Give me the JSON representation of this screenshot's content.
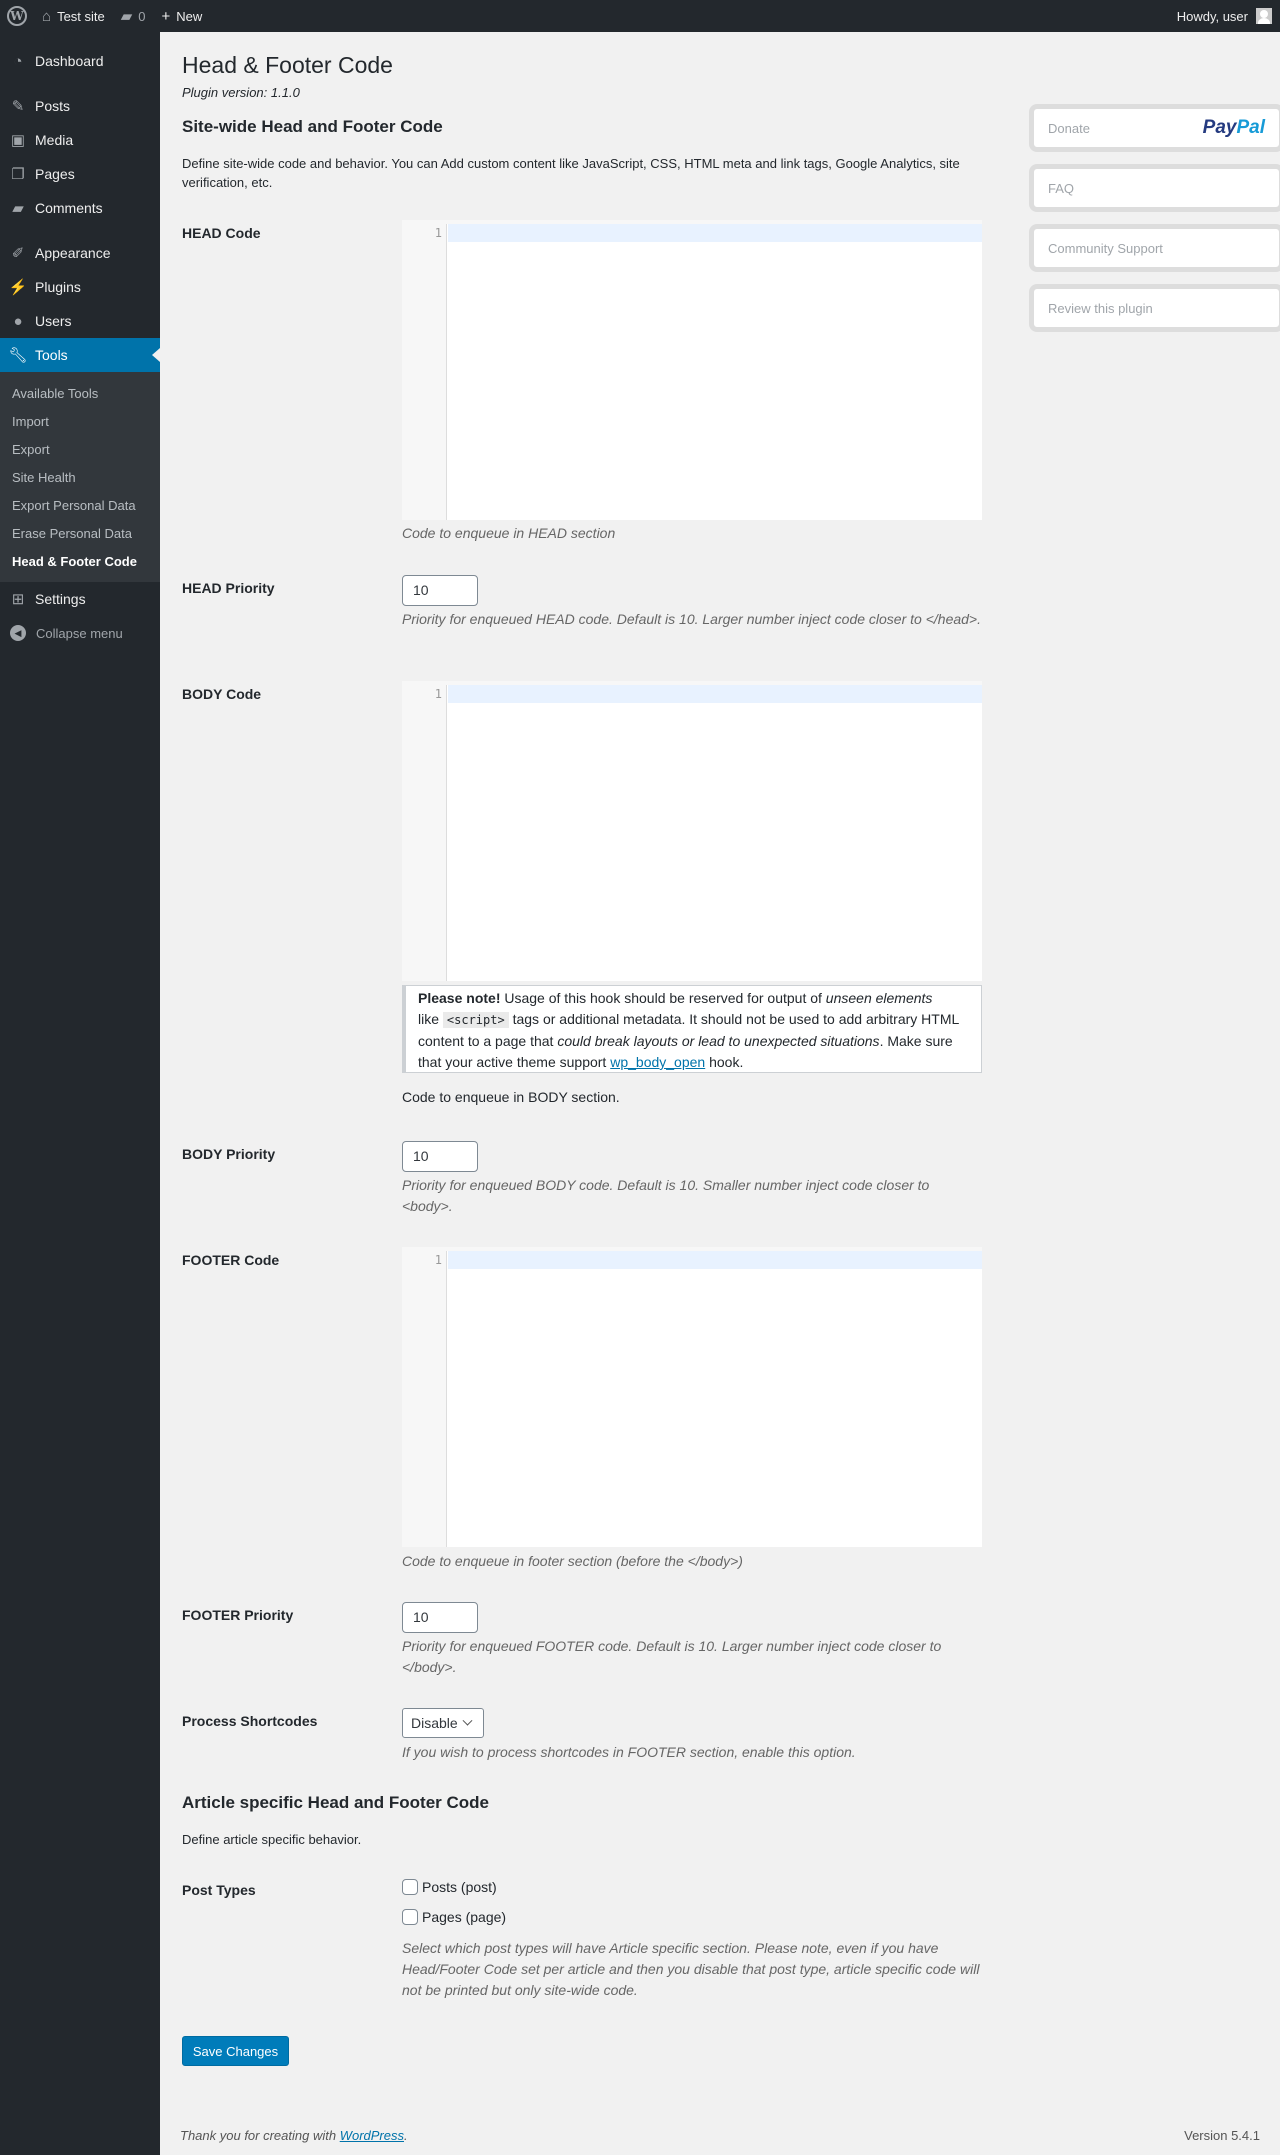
{
  "admin_bar": {
    "site_name": "Test site",
    "comments_count": "0",
    "new_label": "New",
    "howdy": "Howdy, user"
  },
  "sidebar": {
    "items": [
      {
        "label": "Dashboard",
        "icon": "dashboard-icon"
      },
      {
        "label": "Posts",
        "icon": "pin-icon"
      },
      {
        "label": "Media",
        "icon": "media-icon"
      },
      {
        "label": "Pages",
        "icon": "pages-icon"
      },
      {
        "label": "Comments",
        "icon": "comments-icon"
      },
      {
        "label": "Appearance",
        "icon": "brush-icon"
      },
      {
        "label": "Plugins",
        "icon": "plug-icon"
      },
      {
        "label": "Users",
        "icon": "users-icon"
      },
      {
        "label": "Tools",
        "icon": "wrench-icon"
      },
      {
        "label": "Settings",
        "icon": "settings-icon"
      }
    ],
    "submenu": [
      "Available Tools",
      "Import",
      "Export",
      "Site Health",
      "Export Personal Data",
      "Erase Personal Data",
      "Head & Footer Code"
    ],
    "collapse_label": "Collapse menu"
  },
  "page": {
    "title": "Head & Footer Code",
    "plugin_version": "Plugin version: 1.1.0",
    "sitewide_heading": "Site-wide Head and Footer Code",
    "sitewide_description": "Define site-wide code and behavior. You can Add custom content like JavaScript, CSS, HTML meta and link tags, Google Analytics, site verification, etc.",
    "head_code_label": "HEAD Code",
    "head_code_help": "Code to enqueue in HEAD section",
    "head_priority_label": "HEAD Priority",
    "head_priority_value": "10",
    "head_priority_help": "Priority for enqueued HEAD code. Default is 10. Larger number inject code closer to </head>.",
    "body_code_label": "BODY Code",
    "body_notice": {
      "strong": "Please note!",
      "t1": " Usage of this hook should be reserved for output of ",
      "em1": "unseen elements",
      "t2": " like ",
      "code": "<script>",
      "t3": " tags or additional metadata. It should not be used to add arbitrary HTML content to a page that ",
      "em2": "could break layouts or lead to unexpected situations",
      "t4": ". Make sure that your active theme support ",
      "link": "wp_body_open",
      "t5": " hook."
    },
    "body_code_help": "Code to enqueue in BODY section.",
    "body_priority_label": "BODY Priority",
    "body_priority_value": "10",
    "body_priority_help": "Priority for enqueued BODY code. Default is 10. Smaller number inject code closer to <body>.",
    "footer_code_label": "FOOTER Code",
    "footer_code_help": "Code to enqueue in footer section (before the </body>)",
    "footer_priority_label": "FOOTER Priority",
    "footer_priority_value": "10",
    "footer_priority_help": "Priority for enqueued FOOTER code. Default is 10. Larger number inject code closer to </body>.",
    "shortcodes_label": "Process Shortcodes",
    "shortcodes_value": "Disable",
    "shortcodes_help": "If you wish to process shortcodes in FOOTER section, enable this option.",
    "article_heading": "Article specific Head and Footer Code",
    "article_description": "Define article specific behavior.",
    "post_types_label": "Post Types",
    "post_types": [
      "Posts (post)",
      "Pages (page)"
    ],
    "post_types_help": "Select which post types will have Article specific section. Please note, even if you have Head/Footer Code set per article and then you disable that post type, article specific code will not be printed but only site-wide code.",
    "save_label": "Save Changes",
    "editor_line_number": "1"
  },
  "side_boxes": {
    "donate": "Donate",
    "paypal_a": "Pay",
    "paypal_b": "Pal",
    "faq": "FAQ",
    "support": "Community Support",
    "review": "Review this plugin"
  },
  "footer": {
    "thanks_prefix": "Thank you for creating with ",
    "thanks_link": "WordPress",
    "thanks_suffix": ".",
    "version": "Version 5.4.1"
  },
  "colors": {
    "admin_bar": "#23282d",
    "sidebar": "#23282d",
    "accent": "#0073aa",
    "button": "#007cba"
  }
}
